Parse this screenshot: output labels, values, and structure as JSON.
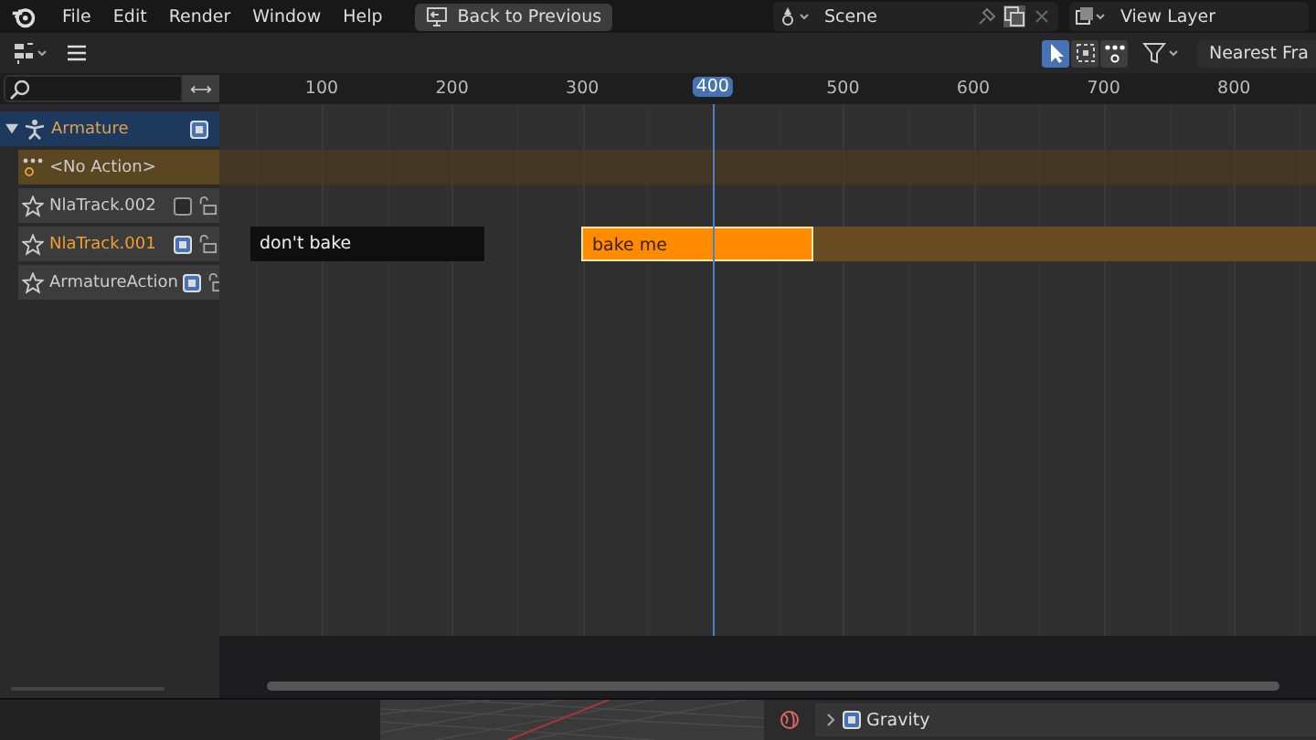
{
  "menu_bar": {
    "menus": [
      "File",
      "Edit",
      "Render",
      "Window",
      "Help"
    ],
    "back_button": "Back to Previous",
    "scene": "Scene",
    "view_layer": "View Layer"
  },
  "header": {
    "select_tools": [
      {
        "selected": true
      },
      {
        "selected": false
      },
      {
        "selected": false
      }
    ],
    "snap_dropdown": "Nearest Fra"
  },
  "ruler": {
    "ticks": [
      {
        "label": "100",
        "selected": false
      },
      {
        "label": "200",
        "selected": false
      },
      {
        "label": "300",
        "selected": false
      },
      {
        "label": "400",
        "selected": true
      },
      {
        "label": "500",
        "selected": false
      },
      {
        "label": "600",
        "selected": false
      },
      {
        "label": "700",
        "selected": false
      },
      {
        "label": "800",
        "selected": false
      }
    ]
  },
  "channels": [
    {
      "kind": "object",
      "name": "Armature",
      "expanded": true,
      "checked": true
    },
    {
      "kind": "action",
      "name": "<No Action>"
    },
    {
      "kind": "track",
      "name": "NlaTrack.002",
      "checked": false,
      "selected": false
    },
    {
      "kind": "track",
      "name": "NlaTrack.001",
      "checked": true,
      "selected": true,
      "strips": [
        {
          "label": "don't bake",
          "selected": false
        },
        {
          "label": "bake me",
          "selected": true
        }
      ]
    },
    {
      "kind": "track",
      "name": "ArmatureAction",
      "checked": true,
      "selected": false
    }
  ],
  "properties": {
    "gravity": {
      "label": "Gravity",
      "checked": true
    }
  }
}
